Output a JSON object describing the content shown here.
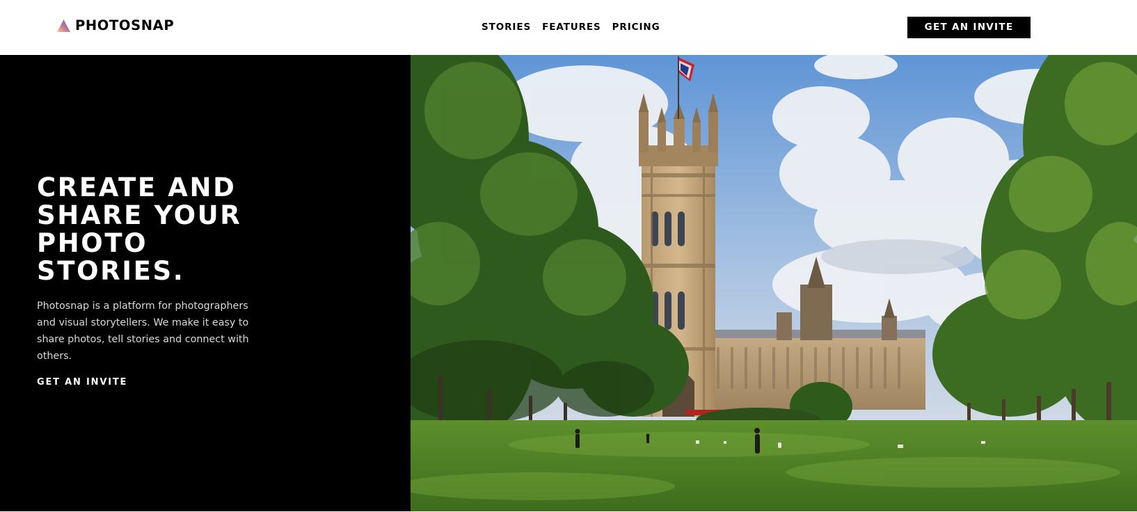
{
  "brand": {
    "name": "PHOTOSNAP",
    "logo_icon": "triangle-gradient-logo-icon",
    "logo_gradient": [
      "#FFC593",
      "#BC7198",
      "#5A77FF"
    ]
  },
  "nav": {
    "links": [
      "STORIES",
      "FEATURES",
      "PRICING"
    ]
  },
  "header_cta": {
    "label": "GET AN INVITE"
  },
  "hero": {
    "title": "CREATE AND\nSHARE YOUR\nPHOTO\nSTORIES.",
    "description": "Photosnap is a platform for photographers and visual storytellers. We make it easy to share photos, tell stories and connect with others.",
    "link_label": "GET AN INVITE",
    "panel_color": "#000000",
    "photo_subject": "Victoria Tower, Palace of Westminster, with trees and lawn"
  },
  "colors": {
    "text_dark": "#000000",
    "text_light": "#FFFFFF",
    "button_bg": "#000000"
  }
}
